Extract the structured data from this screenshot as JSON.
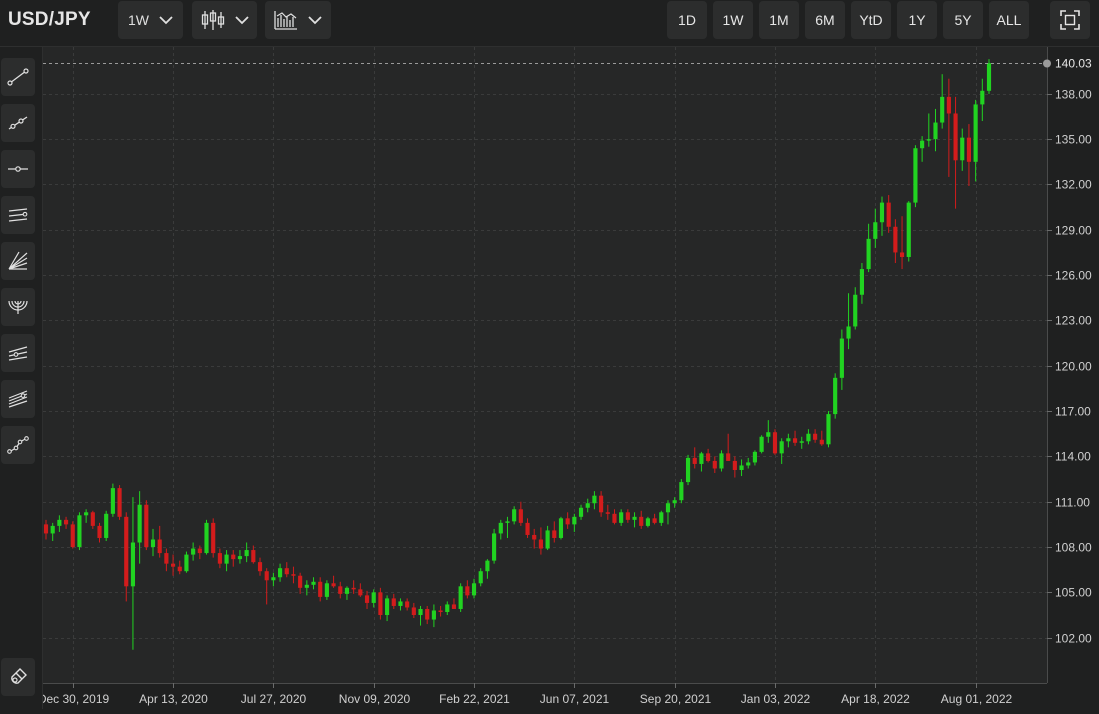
{
  "header": {
    "symbol": "USD/JPY",
    "interval": "1W",
    "ranges": [
      "1D",
      "1W",
      "1M",
      "6M",
      "YtD",
      "1Y",
      "5Y",
      "ALL"
    ]
  },
  "toolbar_icons": [
    "chevron-down-icon",
    "candlestick-icon",
    "indicators-icon",
    "fullscreen-icon"
  ],
  "sidebar_tools": [
    "trend-line-icon",
    "ray-icon",
    "horizontal-line-icon",
    "parallel-channel-icon",
    "fan-lines-icon",
    "fib-arc-icon",
    "fib-retracement-icon",
    "pitchfork-icon",
    "multi-point-line-icon",
    "magnet-icon"
  ],
  "colors": {
    "up": "#21d321",
    "down": "#d31c1c",
    "background": "#262727",
    "grid": "#3a3b3b"
  },
  "chart_data": {
    "type": "candlestick",
    "y_ticks": [
      "102.00",
      "105.00",
      "108.00",
      "111.00",
      "114.00",
      "117.00",
      "120.00",
      "123.00",
      "126.00",
      "129.00",
      "132.00",
      "135.00",
      "138.00"
    ],
    "x_ticks": [
      "Dec 30, 2019",
      "Apr 13, 2020",
      "Jul 27, 2020",
      "Nov 09, 2020",
      "Feb 22, 2021",
      "Jun 07, 2021",
      "Sep 20, 2021",
      "Jan 03, 2022",
      "Apr 18, 2022",
      "Aug 01, 2022"
    ],
    "ylim": [
      99.0,
      141.1
    ],
    "last_price": "140.03",
    "grid": true,
    "candles": [
      [
        109.5,
        109.8,
        108.5,
        108.9
      ],
      [
        108.9,
        109.6,
        108.4,
        109.4
      ],
      [
        109.4,
        110.1,
        109.0,
        109.8
      ],
      [
        109.8,
        110.0,
        109.2,
        109.5
      ],
      [
        109.5,
        109.7,
        107.9,
        108.0
      ],
      [
        108.0,
        110.3,
        107.8,
        110.1
      ],
      [
        110.1,
        110.5,
        109.6,
        110.3
      ],
      [
        110.3,
        110.4,
        109.2,
        109.4
      ],
      [
        109.4,
        109.6,
        108.3,
        108.6
      ],
      [
        108.6,
        110.4,
        108.4,
        110.2
      ],
      [
        110.2,
        112.2,
        110.0,
        111.9
      ],
      [
        111.9,
        112.1,
        109.8,
        110.0
      ],
      [
        110.0,
        110.3,
        104.4,
        105.4
      ],
      [
        105.4,
        111.3,
        101.2,
        108.3
      ],
      [
        108.3,
        111.7,
        106.9,
        110.8
      ],
      [
        110.8,
        111.1,
        107.8,
        108.0
      ],
      [
        108.0,
        109.2,
        107.4,
        108.5
      ],
      [
        108.5,
        109.4,
        107.3,
        107.6
      ],
      [
        107.6,
        107.9,
        106.4,
        106.9
      ],
      [
        106.9,
        107.5,
        106.1,
        106.7
      ],
      [
        106.7,
        107.1,
        106.2,
        106.4
      ],
      [
        106.4,
        107.7,
        106.3,
        107.5
      ],
      [
        107.5,
        108.3,
        107.1,
        107.9
      ],
      [
        107.9,
        108.1,
        107.2,
        107.6
      ],
      [
        107.6,
        109.8,
        107.5,
        109.6
      ],
      [
        109.6,
        109.9,
        107.3,
        107.6
      ],
      [
        107.6,
        107.9,
        106.6,
        106.9
      ],
      [
        106.9,
        107.8,
        106.4,
        107.5
      ],
      [
        107.5,
        107.8,
        106.7,
        107.2
      ],
      [
        107.2,
        107.8,
        106.9,
        107.4
      ],
      [
        107.4,
        108.3,
        107.0,
        107.8
      ],
      [
        107.8,
        108.1,
        106.9,
        107.0
      ],
      [
        107.0,
        107.3,
        106.1,
        106.4
      ],
      [
        106.4,
        106.6,
        104.2,
        105.8
      ],
      [
        105.8,
        106.3,
        105.4,
        106.0
      ],
      [
        106.0,
        106.9,
        105.7,
        106.6
      ],
      [
        106.6,
        107.0,
        106.0,
        106.2
      ],
      [
        106.2,
        106.7,
        105.6,
        106.1
      ],
      [
        106.1,
        106.3,
        104.9,
        105.3
      ],
      [
        105.3,
        105.8,
        104.8,
        105.5
      ],
      [
        105.5,
        106.0,
        105.2,
        105.7
      ],
      [
        105.7,
        106.0,
        104.4,
        104.7
      ],
      [
        104.7,
        105.8,
        104.5,
        105.6
      ],
      [
        105.6,
        106.1,
        105.3,
        105.4
      ],
      [
        105.4,
        105.7,
        104.6,
        104.9
      ],
      [
        104.9,
        105.4,
        104.5,
        105.3
      ],
      [
        105.3,
        105.8,
        104.9,
        105.2
      ],
      [
        105.2,
        105.6,
        104.7,
        104.8
      ],
      [
        104.8,
        105.1,
        103.9,
        104.3
      ],
      [
        104.3,
        105.2,
        104.0,
        105.0
      ],
      [
        105.0,
        105.3,
        103.2,
        103.5
      ],
      [
        103.5,
        104.8,
        103.1,
        104.6
      ],
      [
        104.6,
        104.9,
        103.9,
        104.1
      ],
      [
        104.1,
        104.6,
        103.8,
        104.4
      ],
      [
        104.4,
        104.6,
        103.8,
        104.0
      ],
      [
        104.0,
        104.3,
        103.3,
        103.5
      ],
      [
        103.5,
        104.1,
        102.8,
        103.9
      ],
      [
        103.9,
        104.1,
        102.9,
        103.2
      ],
      [
        103.2,
        104.2,
        102.7,
        103.8
      ],
      [
        103.8,
        104.1,
        103.4,
        103.7
      ],
      [
        103.7,
        104.4,
        103.5,
        104.2
      ],
      [
        104.2,
        104.6,
        103.9,
        103.9
      ],
      [
        103.9,
        105.6,
        103.7,
        105.4
      ],
      [
        105.4,
        105.8,
        104.6,
        104.8
      ],
      [
        104.8,
        105.9,
        104.6,
        105.6
      ],
      [
        105.6,
        106.6,
        105.4,
        106.4
      ],
      [
        106.4,
        107.2,
        105.9,
        107.1
      ],
      [
        107.1,
        109.2,
        106.9,
        108.9
      ],
      [
        108.9,
        109.8,
        108.5,
        109.6
      ],
      [
        109.6,
        110.0,
        108.6,
        109.7
      ],
      [
        109.7,
        110.7,
        109.5,
        110.5
      ],
      [
        110.5,
        111.0,
        109.4,
        109.6
      ],
      [
        109.6,
        109.9,
        108.6,
        108.8
      ],
      [
        108.8,
        109.2,
        107.9,
        108.5
      ],
      [
        108.5,
        109.3,
        107.5,
        107.9
      ],
      [
        107.9,
        109.4,
        107.8,
        109.1
      ],
      [
        109.1,
        109.7,
        108.3,
        108.6
      ],
      [
        108.6,
        110.0,
        108.5,
        109.9
      ],
      [
        109.9,
        110.3,
        109.2,
        109.5
      ],
      [
        109.5,
        110.2,
        109.0,
        110.0
      ],
      [
        110.0,
        110.8,
        109.8,
        110.6
      ],
      [
        110.6,
        111.2,
        110.3,
        110.9
      ],
      [
        110.9,
        111.7,
        110.5,
        111.4
      ],
      [
        111.4,
        111.7,
        110.0,
        110.3
      ],
      [
        110.3,
        110.8,
        109.8,
        110.2
      ],
      [
        110.2,
        110.5,
        109.5,
        109.6
      ],
      [
        109.6,
        110.5,
        109.4,
        110.3
      ],
      [
        110.3,
        110.5,
        109.6,
        109.8
      ],
      [
        109.8,
        110.3,
        109.3,
        110.0
      ],
      [
        110.0,
        110.4,
        109.2,
        109.4
      ],
      [
        109.4,
        110.0,
        109.3,
        109.9
      ],
      [
        109.9,
        110.2,
        109.5,
        109.6
      ],
      [
        109.6,
        110.4,
        109.4,
        110.3
      ],
      [
        110.3,
        111.1,
        109.5,
        110.9
      ],
      [
        110.9,
        111.3,
        110.6,
        111.1
      ],
      [
        111.1,
        112.5,
        110.9,
        112.3
      ],
      [
        112.3,
        114.1,
        112.1,
        113.9
      ],
      [
        113.9,
        114.6,
        113.2,
        113.5
      ],
      [
        113.5,
        114.3,
        113.0,
        114.2
      ],
      [
        114.2,
        114.5,
        113.6,
        113.7
      ],
      [
        113.7,
        114.0,
        112.9,
        113.2
      ],
      [
        113.2,
        114.4,
        113.0,
        114.2
      ],
      [
        114.2,
        115.5,
        113.7,
        113.7
      ],
      [
        113.7,
        114.0,
        112.6,
        113.1
      ],
      [
        113.1,
        113.8,
        112.7,
        113.4
      ],
      [
        113.4,
        113.9,
        113.2,
        113.6
      ],
      [
        113.6,
        114.4,
        113.4,
        114.3
      ],
      [
        114.3,
        115.4,
        114.2,
        115.3
      ],
      [
        115.3,
        116.4,
        114.9,
        115.6
      ],
      [
        115.6,
        115.8,
        114.1,
        114.2
      ],
      [
        114.2,
        115.2,
        113.5,
        115.0
      ],
      [
        115.0,
        115.5,
        114.6,
        115.2
      ],
      [
        115.2,
        115.7,
        114.7,
        114.9
      ],
      [
        114.9,
        115.3,
        114.5,
        115.0
      ],
      [
        115.0,
        115.8,
        114.8,
        115.5
      ],
      [
        115.5,
        115.8,
        114.9,
        115.1
      ],
      [
        115.1,
        115.7,
        114.7,
        114.8
      ],
      [
        114.8,
        117.0,
        114.6,
        116.8
      ],
      [
        116.8,
        119.5,
        116.5,
        119.2
      ],
      [
        119.2,
        122.4,
        118.4,
        121.8
      ],
      [
        121.8,
        124.8,
        121.1,
        122.6
      ],
      [
        122.6,
        125.2,
        122.4,
        124.7
      ],
      [
        124.7,
        126.8,
        124.1,
        126.4
      ],
      [
        126.4,
        129.4,
        126.2,
        128.4
      ],
      [
        128.4,
        130.4,
        127.8,
        129.5
      ],
      [
        129.5,
        131.2,
        128.6,
        130.8
      ],
      [
        130.8,
        131.3,
        128.8,
        129.2
      ],
      [
        129.2,
        129.7,
        126.8,
        127.5
      ],
      [
        127.5,
        129.9,
        126.4,
        127.2
      ],
      [
        127.2,
        130.9,
        126.9,
        130.8
      ],
      [
        130.8,
        134.6,
        130.5,
        134.4
      ],
      [
        134.4,
        135.2,
        133.5,
        134.9
      ],
      [
        134.9,
        136.7,
        134.5,
        135.0
      ],
      [
        135.0,
        137.0,
        134.2,
        136.1
      ],
      [
        136.1,
        139.3,
        135.7,
        137.8
      ],
      [
        137.8,
        139.0,
        132.5,
        136.7
      ],
      [
        136.7,
        137.8,
        130.4,
        133.6
      ],
      [
        133.6,
        135.7,
        132.9,
        135.1
      ],
      [
        135.1,
        136.0,
        131.9,
        133.5
      ],
      [
        133.5,
        137.6,
        132.2,
        137.3
      ],
      [
        137.3,
        139.0,
        136.2,
        138.2
      ],
      [
        138.2,
        140.3,
        138.0,
        140.03
      ]
    ]
  }
}
